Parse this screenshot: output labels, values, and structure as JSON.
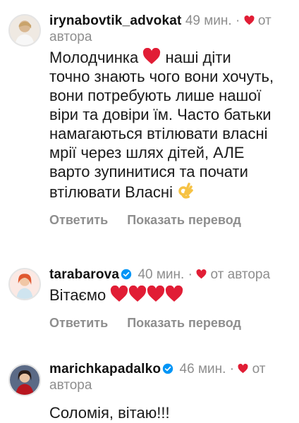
{
  "comments": [
    {
      "username": "irynabovtik_advokat",
      "time": "49 мин.",
      "separator": "·",
      "by_author": "от автора",
      "text_lines": [
        "Молодчинка",
        " наші діти",
        "точно знають чого вони хочуть,",
        "вони потребують лише нашої",
        "віри та довіри їм. Часто батьки",
        "намагаються втілювати власні",
        "мрії через шлях дітей, АЛЕ",
        "варто зупинитися та почати",
        "втілювати Власні"
      ],
      "reply": "Ответить",
      "translate": "Показать перевод"
    },
    {
      "username": "tarabarova",
      "verified": true,
      "time": "40 мин.",
      "separator": "·",
      "by_author": "от автора",
      "text": "Вітаємо",
      "reply": "Ответить",
      "translate": "Показать перевод"
    },
    {
      "username": "marichkapadalko",
      "verified": true,
      "time": "46 мин.",
      "separator": "·",
      "by_author_line1": "от",
      "by_author_line2": "автора",
      "text": "Соломія, вітаю!!!"
    }
  ],
  "icons": {
    "heart_color": "#e11d35",
    "verified_color": "#0095f6",
    "ok_hand_color": "#f6c244"
  }
}
